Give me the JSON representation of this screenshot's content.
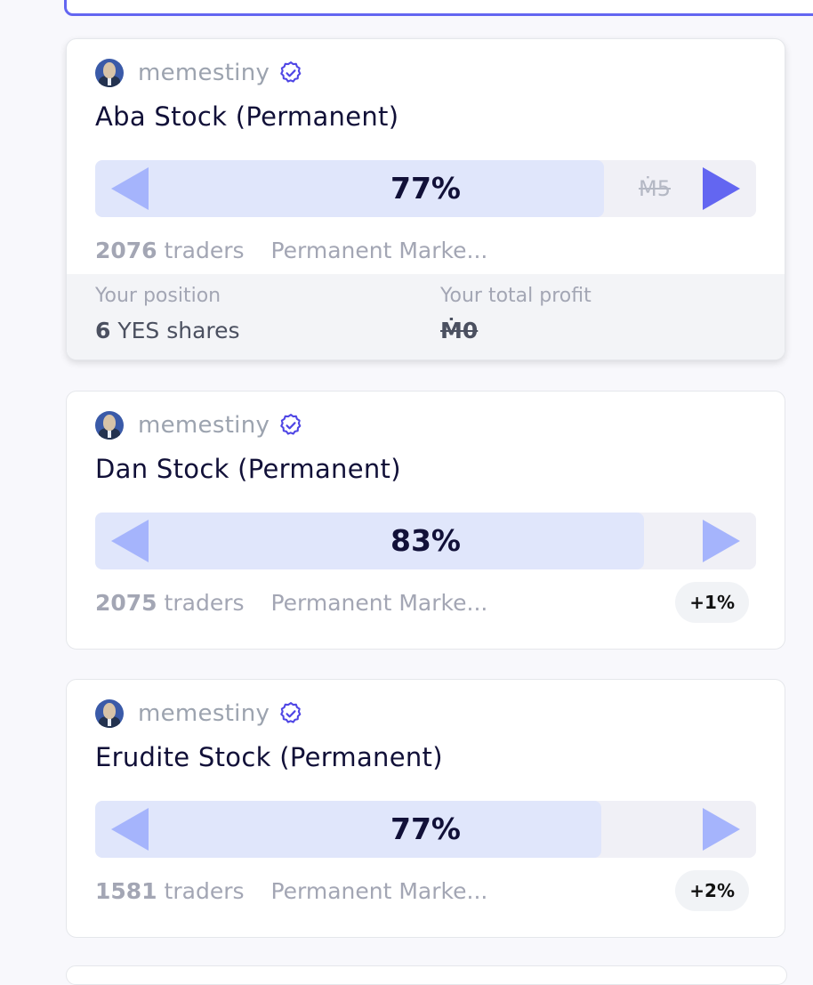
{
  "colors": {
    "accent": "#6366f1",
    "bar_fill": "#e0e6fb",
    "bar_track": "#f0f0f6",
    "arrow": "#a5b4fc",
    "muted_text": "#a3a6b4",
    "title_text": "#111038"
  },
  "markets": [
    {
      "creator": "memestiny",
      "creator_icon": "verified-badge-icon",
      "title": "Aba Stock (Permanent)",
      "probability": "77%",
      "probability_value": 0.77,
      "bet_amount": "Ṁ5",
      "traders_count": "2076",
      "traders_label": "traders",
      "group": "Permanent Marke...",
      "position": {
        "label": "Your position",
        "shares_count": "6",
        "shares_label": "YES shares",
        "profit_label": "Your total profit",
        "profit_value": "Ṁ0"
      }
    },
    {
      "creator": "memestiny",
      "creator_icon": "verified-badge-icon",
      "title": "Dan Stock (Permanent)",
      "probability": "83%",
      "probability_value": 0.83,
      "traders_count": "2075",
      "traders_label": "traders",
      "group": "Permanent Marke...",
      "change": "+1%"
    },
    {
      "creator": "memestiny",
      "creator_icon": "verified-badge-icon",
      "title": "Erudite Stock (Permanent)",
      "probability": "77%",
      "probability_value": 0.766,
      "traders_count": "1581",
      "traders_label": "traders",
      "group": "Permanent Marke...",
      "change": "+2%"
    }
  ]
}
